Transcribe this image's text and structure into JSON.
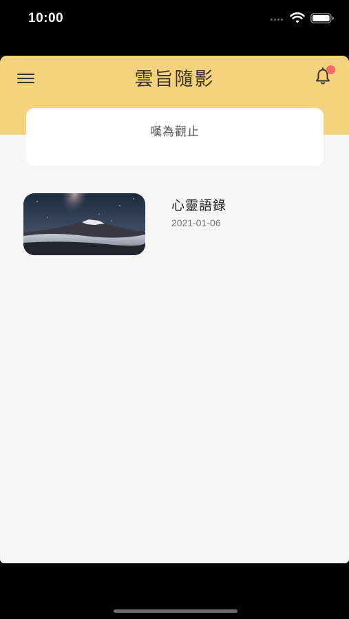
{
  "status_bar": {
    "time": "10:00"
  },
  "header": {
    "title": "雲旨隨影",
    "menu_icon": "hamburger-menu-icon",
    "bell_icon": "bell-icon",
    "background_color": "#f5d27d",
    "badge_color": "#f26a6a"
  },
  "notice": {
    "text": "嘆為觀止"
  },
  "articles": [
    {
      "title": "心靈語錄",
      "date": "2021-01-06",
      "thumbnail": "mountain-milky-way-night-photo"
    }
  ]
}
